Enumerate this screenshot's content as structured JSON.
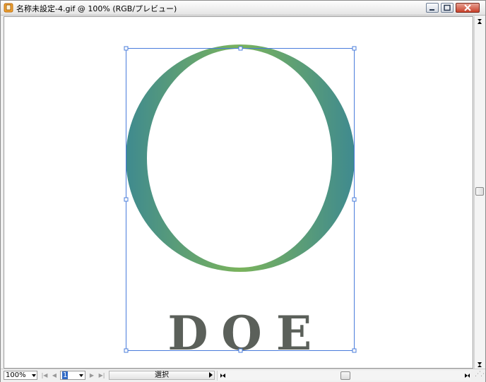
{
  "window": {
    "title": "名称未設定-4.gif @ 100% (RGB/プレビュー)"
  },
  "artwork": {
    "text_letters": [
      "D",
      "O",
      "E"
    ],
    "ring_gradient": [
      "#3f8a8f",
      "#7ab35c"
    ],
    "text_color": "#5b605a",
    "selection_color": "#4a7cdb"
  },
  "status": {
    "zoom": "100%",
    "page": "1",
    "mode": "選択"
  },
  "icons": {
    "app": "illustrator-doc-icon",
    "minimize": "minimize-icon",
    "maximize": "maximize-icon",
    "close": "close-icon"
  }
}
